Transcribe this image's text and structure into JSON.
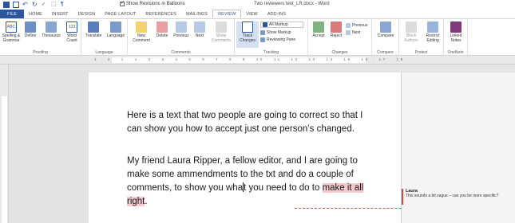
{
  "titlebar": {
    "doc_title": "Two reviewers text_LR.docx - Word",
    "balloons_label": "Show Revisions in Balloons"
  },
  "tabs": [
    "FILE",
    "HOME",
    "INSERT",
    "DESIGN",
    "PAGE LAYOUT",
    "REFERENCES",
    "MAILINGS",
    "REVIEW",
    "VIEW",
    "ADD-INS"
  ],
  "active_tab": "REVIEW",
  "ribbon": {
    "proofing": {
      "label": "Proofing",
      "spelling": "Spelling & Grammar",
      "define": "Define",
      "thesaurus": "Thesaurus",
      "word_count": "Word Count"
    },
    "language": {
      "label": "Language",
      "translate": "Translate",
      "language": "Language"
    },
    "comments": {
      "label": "Comments",
      "new": "New Comment",
      "delete": "Delete",
      "previous": "Previous",
      "next": "Next",
      "show": "Show Comments"
    },
    "tracking": {
      "label": "Tracking",
      "track": "Track Changes",
      "markup_select": "All Markup",
      "show_markup": "Show Markup",
      "reviewing_pane": "Reviewing Pane"
    },
    "changes": {
      "label": "Changes",
      "accept": "Accept",
      "reject": "Reject",
      "previous": "Previous",
      "next": "Next"
    },
    "compare": {
      "label": "Compare",
      "compare": "Compare"
    },
    "protect": {
      "label": "Protect",
      "block": "Block Authors",
      "restrict": "Restrict Editing"
    },
    "onenote": {
      "label": "OneNote",
      "linked": "Linked Notes"
    }
  },
  "ruler": {
    "numbers": "1 · 2 · 1 · 1 · 2 · 3 · 4 · 5 · 6 · 7 · 8 · 9 · 10 · 11 · 12 · 13 · 14 · 15 · 16 · 17 · 18"
  },
  "document": {
    "p1": "Here is a text that two people are going to correct so that I can show you how to accept just one person’s changed.",
    "p2_before": "My friend Laura Ripper, a fellow editor, and I are going to make some ammendments to the txt and do a couple of comments, to show you wha",
    "p2_mid": "t you need to do to ",
    "p2_highlight": "make it all right",
    "p2_end": "."
  },
  "comment": {
    "author": "Laura",
    "text": "This sounds a bit vague – can you be more specific?"
  },
  "colors": {
    "file_tab": "#2b579a",
    "comment": "#c0504d",
    "highlight": "#f6c9cf"
  }
}
